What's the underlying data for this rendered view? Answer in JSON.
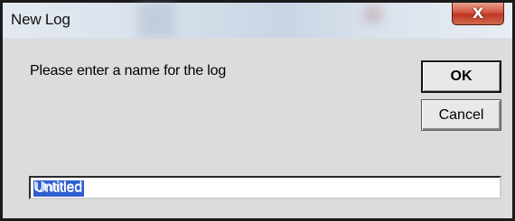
{
  "window": {
    "title": "New Log",
    "close_label": "X"
  },
  "dialog": {
    "prompt": "Please enter a name for the log",
    "ok_label": "OK",
    "cancel_label": "Cancel",
    "name_input": {
      "value": "Untitled",
      "selected": true
    }
  },
  "colors": {
    "selection": "#2f5fd0",
    "close_button": "#c9452f",
    "dialog_background": "#dcdcdc"
  },
  "icons": {
    "close": "close-icon"
  }
}
